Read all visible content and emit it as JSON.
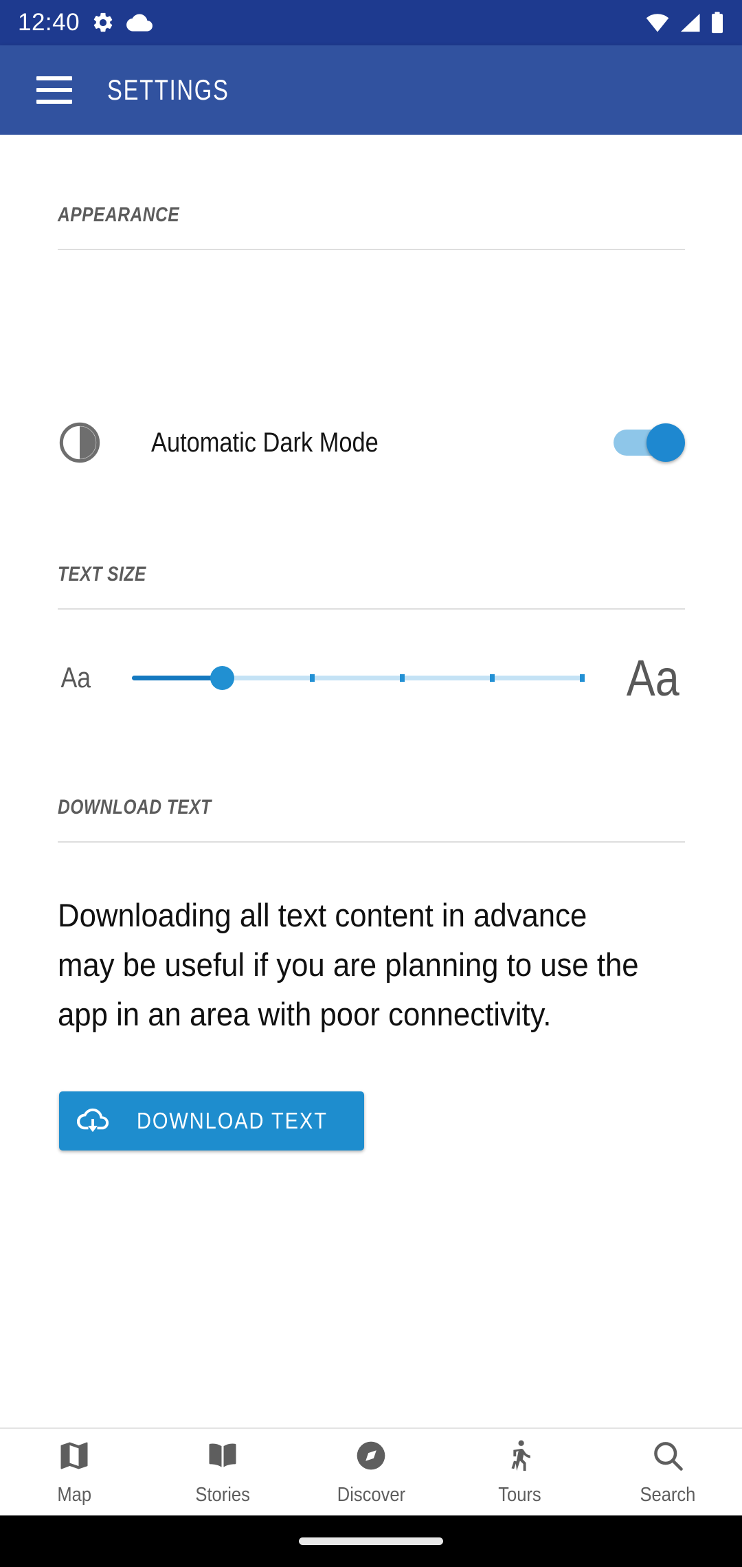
{
  "status_bar": {
    "time": "12:40",
    "left_icons": [
      "gear-icon",
      "cloud-icon"
    ],
    "right_icons": [
      "wifi-icon",
      "cellular-signal-icon",
      "battery-icon"
    ],
    "background_color": "#1E3A8F"
  },
  "app_bar": {
    "menu_icon": "hamburger-menu-icon",
    "title": "SETTINGS",
    "background_color": "#31529F"
  },
  "sections": {
    "appearance": {
      "heading": "APPEARANCE",
      "dark_mode": {
        "icon": "contrast-icon",
        "label": "Automatic Dark Mode",
        "toggle_on": true,
        "toggle_track_color": "#8EC6E9",
        "toggle_thumb_color": "#1E88D0"
      }
    },
    "text_size": {
      "heading": "TEXT SIZE",
      "small_label": "Aa",
      "large_label": "Aa",
      "slider": {
        "value": 1,
        "min": 0,
        "max": 5,
        "ticks": 6,
        "active_color": "#1479C0",
        "inactive_color": "#C4E2F5",
        "thumb_color": "#2190D2"
      }
    },
    "download_text": {
      "heading": "DOWNLOAD TEXT",
      "description": "Downloading all text content in advance may be useful if you are planning to use the app in an area with poor connectivity.",
      "button": {
        "icon": "cloud-download-icon",
        "label": "DOWNLOAD TEXT",
        "color": "#1E8DCE"
      }
    }
  },
  "bottom_nav": {
    "items": [
      {
        "label": "Map",
        "icon": "map-icon"
      },
      {
        "label": "Stories",
        "icon": "book-icon"
      },
      {
        "label": "Discover",
        "icon": "compass-icon"
      },
      {
        "label": "Tours",
        "icon": "walking-person-icon"
      },
      {
        "label": "Search",
        "icon": "search-icon"
      }
    ],
    "icon_color": "#5E5E5E"
  }
}
